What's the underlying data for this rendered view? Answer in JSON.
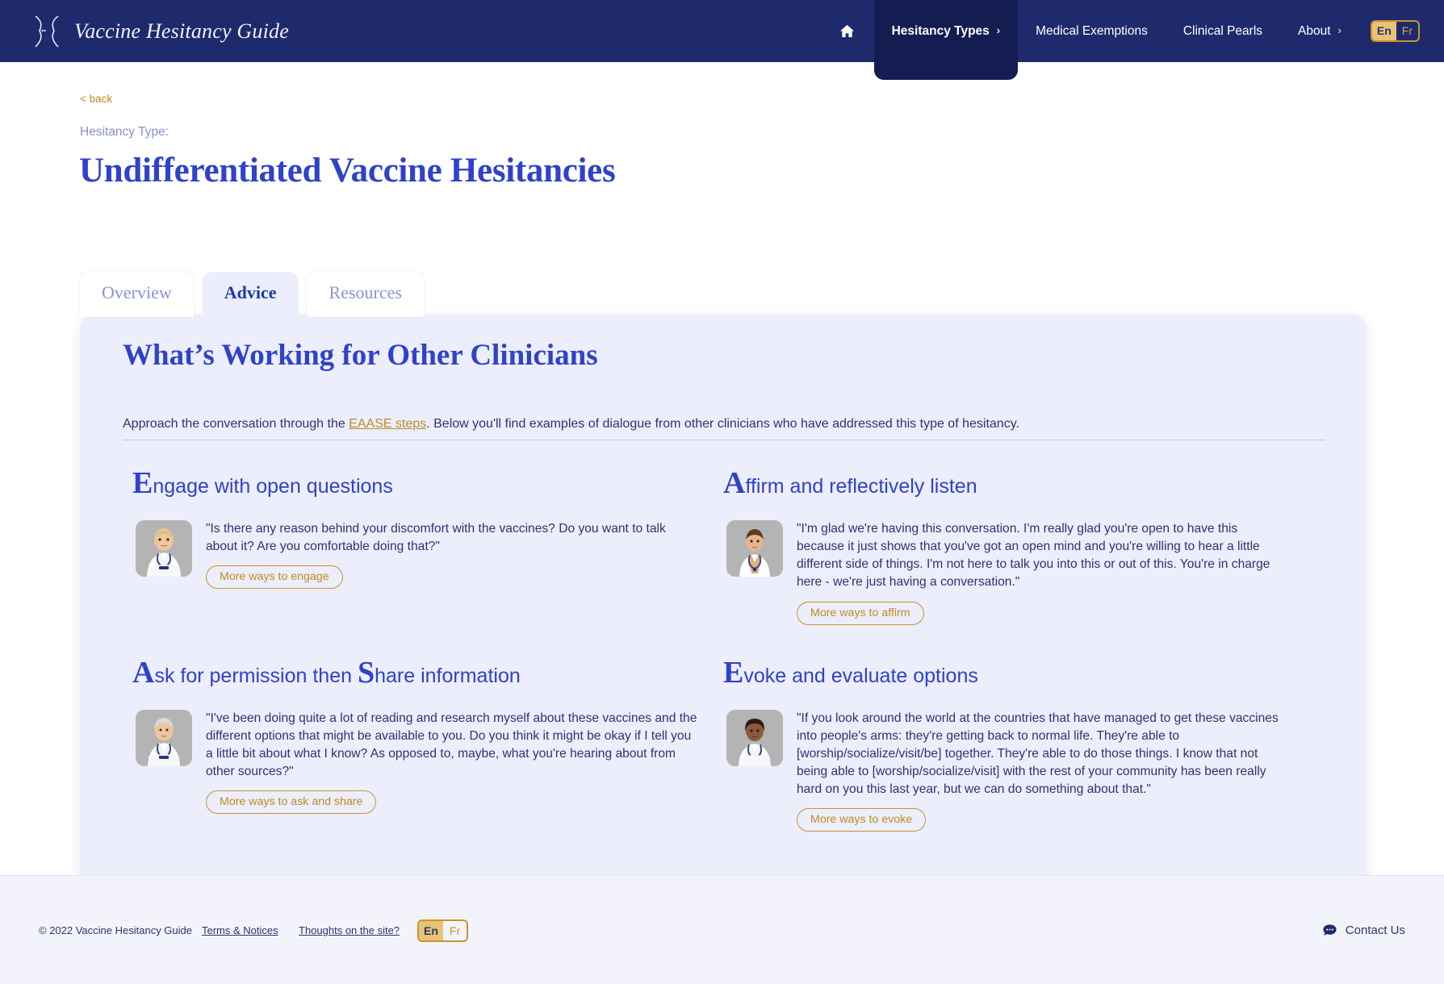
{
  "header": {
    "brand_title": "Vaccine Hesitancy Guide",
    "logo_icon": "speech-brackets-logo",
    "nav": [
      {
        "id": "home",
        "label": "",
        "icon": "home-icon",
        "active": false,
        "chevron": false
      },
      {
        "id": "hesitancy-types",
        "label": "Hesitancy Types",
        "icon": "",
        "active": true,
        "chevron": true
      },
      {
        "id": "medical-exemptions",
        "label": "Medical Exemptions",
        "icon": "",
        "active": false,
        "chevron": false
      },
      {
        "id": "clinical-pearls",
        "label": "Clinical Pearls",
        "icon": "",
        "active": false,
        "chevron": false
      },
      {
        "id": "about",
        "label": "About",
        "icon": "",
        "active": false,
        "chevron": true
      }
    ],
    "lang": {
      "active": "En",
      "inactive": "Fr"
    }
  },
  "breadcrumb": {
    "back_label": "< back"
  },
  "page": {
    "eyebrow": "Hesitancy Type:",
    "title": "Undifferentiated Vaccine Hesitancies"
  },
  "tabs": [
    {
      "id": "overview",
      "label": "Overview",
      "active": false
    },
    {
      "id": "advice",
      "label": "Advice",
      "active": true
    },
    {
      "id": "resources",
      "label": "Resources",
      "active": false
    }
  ],
  "card": {
    "title": "What’s Working for Other Clinicians",
    "intro_before": "Approach the conversation through the ",
    "intro_link": "EAASE steps",
    "intro_after": ". Below you'll find examples of dialogue from other clinicians who have addressed this type of hesitancy.",
    "steps": [
      {
        "id": "engage",
        "cap": "E",
        "head_rest": "ngage with open questions",
        "avatar": "clinician-avatar-bald-man",
        "quote": "\"Is there any reason behind your discomfort with the vaccines? Do you want to talk about it? Are you comfortable doing that?\"",
        "button": "More ways to engage"
      },
      {
        "id": "affirm",
        "cap": "A",
        "head_rest": "ffirm and reflectively listen",
        "avatar": "clinician-avatar-young-man",
        "quote": "\"I'm glad we're having this conversation. I'm really glad you're open to have this because it just shows that you've got an open mind and you're willing to hear a little different side of things. I'm not here to talk you into this or out of this. You're in charge here - we're just having a conversation.\"",
        "button": "More ways to affirm"
      },
      {
        "id": "ask-share",
        "cap": "A",
        "cap2": "S",
        "head_mid": "sk for permission then ",
        "head_rest": "hare information",
        "avatar": "clinician-avatar-grey-haired-man",
        "quote": "\"I've been doing quite a lot of reading and research myself about these vaccines and the different options that might be available to you. Do you think it might be okay if I tell you a little bit about what I know? As opposed to, maybe, what you're hearing about from other sources?\"",
        "button": "More ways to ask and share"
      },
      {
        "id": "evoke",
        "cap": "E",
        "head_rest": "voke and evaluate options",
        "avatar": "clinician-avatar-woman",
        "quote": "\"If you look around the world at the countries that have managed to get these vaccines into people's arms: they're getting back to normal life. They're able to [worship/socialize/visit/be] together. They're able to do those things. I know that not being able to [worship/socialize/visit] with the rest of your community has been really hard on you this last year, but we can do something about that.\"",
        "button": "More ways to evoke"
      }
    ]
  },
  "footer": {
    "copyright": "© 2022 Vaccine Hesitancy Guide",
    "terms_link": "Terms & Notices",
    "thoughts_link": "Thoughts on the site?",
    "lang": {
      "active": "En",
      "inactive": "Fr"
    },
    "contact_label": "Contact Us",
    "contact_icon": "chat-bubble-icon"
  },
  "colors": {
    "header_bg": "#1f2a6d",
    "accent_gold": "#bf8b22",
    "brand_blue": "#2f42c9",
    "card_bg": "#eceefb",
    "text_blue": "#2b3470"
  }
}
